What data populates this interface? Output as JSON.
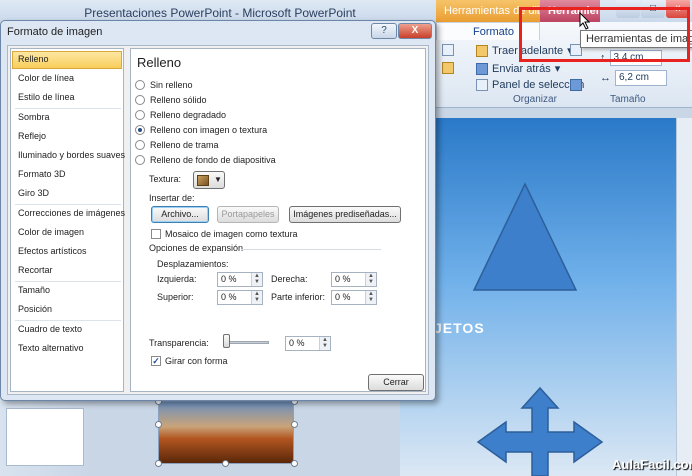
{
  "app": {
    "title": "Presentaciones PowerPoint - Microsoft PowerPoint",
    "context_tab_drawing": "Herramientas de dibujo",
    "context_tab_image": "Herramient...",
    "window_minimize": "–",
    "window_restore": "□",
    "window_close": "x",
    "tooltip": "Herramientas de imagen",
    "ribbon": {
      "active_tab": "Formato",
      "bring_forward": "Traer adelante",
      "send_backward": "Enviar atrás",
      "selection_pane": "Panel de selección",
      "group_organize": "Organizar",
      "group_size": "Tamaño",
      "height_value": "3,4 cm",
      "width_value": "6,2 cm"
    },
    "slide_text": "JETOS",
    "brand": "AulaFacil.com",
    "annotation_color": "#e8231f"
  },
  "dialog": {
    "title": "Formato de imagen",
    "help_label": "?",
    "close_label": "X",
    "categories": [
      "Relleno",
      "Color de línea",
      "Estilo de línea",
      "Sombra",
      "Reflejo",
      "Iluminado y bordes suaves",
      "Formato 3D",
      "Giro 3D",
      "Correcciones de imágenes",
      "Color de imagen",
      "Efectos artísticos",
      "Recortar",
      "Tamaño",
      "Posición",
      "Cuadro de texto",
      "Texto alternativo"
    ],
    "selected_category": "Relleno",
    "panel_heading": "Relleno",
    "fill_options": [
      "Sin relleno",
      "Relleno sólido",
      "Relleno degradado",
      "Relleno con imagen o textura",
      "Relleno de trama",
      "Relleno de fondo de diapositiva"
    ],
    "selected_fill": "Relleno con imagen o textura",
    "texture_label": "Textura:",
    "insert_from_label": "Insertar de:",
    "btn_file": "Archivo...",
    "btn_clipboard": "Portapapeles",
    "btn_clipart": "Imágenes prediseñadas...",
    "tile_label": "Mosaico de imagen como textura",
    "tile_checked": false,
    "stretch_options_label": "Opciones de expansión",
    "offsets_label": "Desplazamientos:",
    "left_label": "Izquierda:",
    "left_value": "0 %",
    "right_label": "Derecha:",
    "right_value": "0 %",
    "top_label": "Superior:",
    "top_value": "0 %",
    "bottom_label": "Parte inferior:",
    "bottom_value": "0 %",
    "transparency_label": "Transparencia:",
    "transparency_value": "0 %",
    "transparency_level": 0,
    "rotate_label": "Girar con forma",
    "rotate_checked": true,
    "close_button": "Cerrar"
  }
}
